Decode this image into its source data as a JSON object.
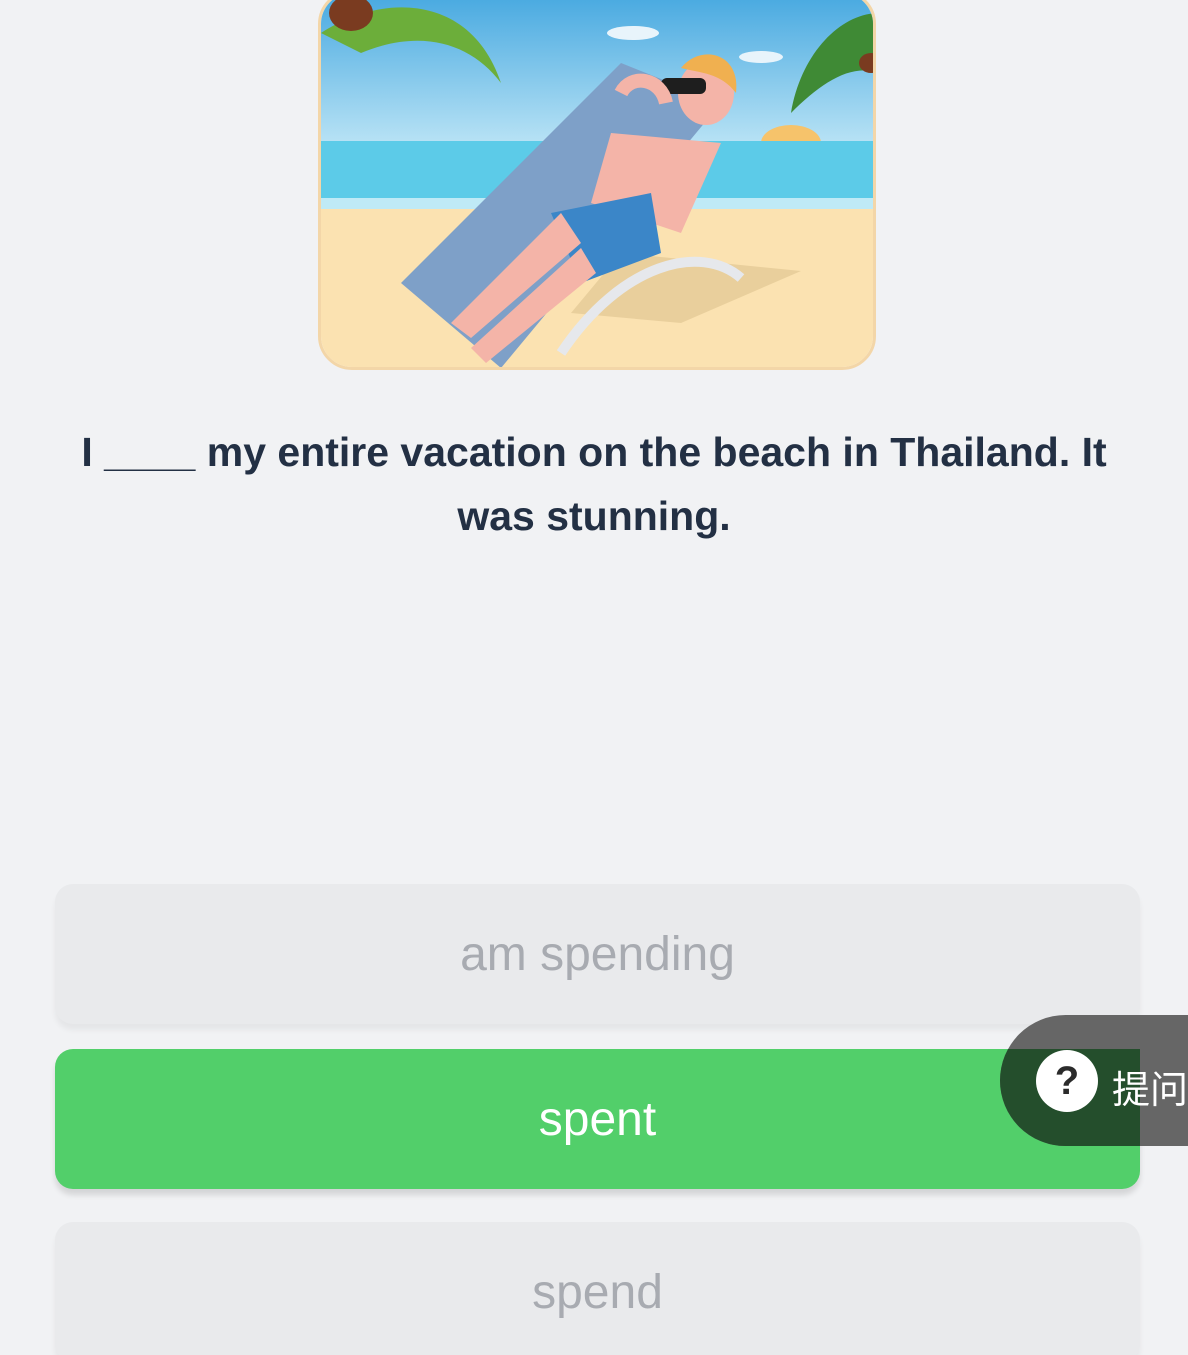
{
  "question": {
    "text": "I ____ my entire vacation on the beach in Thailand. It was stunning."
  },
  "options": [
    {
      "label": "am spending",
      "state": "dim"
    },
    {
      "label": "spent",
      "state": "selected"
    },
    {
      "label": "spend",
      "state": "dim"
    }
  ],
  "ask_button": {
    "icon": "question-mark-icon",
    "icon_glyph": "?",
    "label": "提问"
  },
  "colors": {
    "background": "#f1f2f4",
    "selected_option": "#52cf6a",
    "dim_option": "#e9eaec",
    "question_text": "#233044"
  }
}
